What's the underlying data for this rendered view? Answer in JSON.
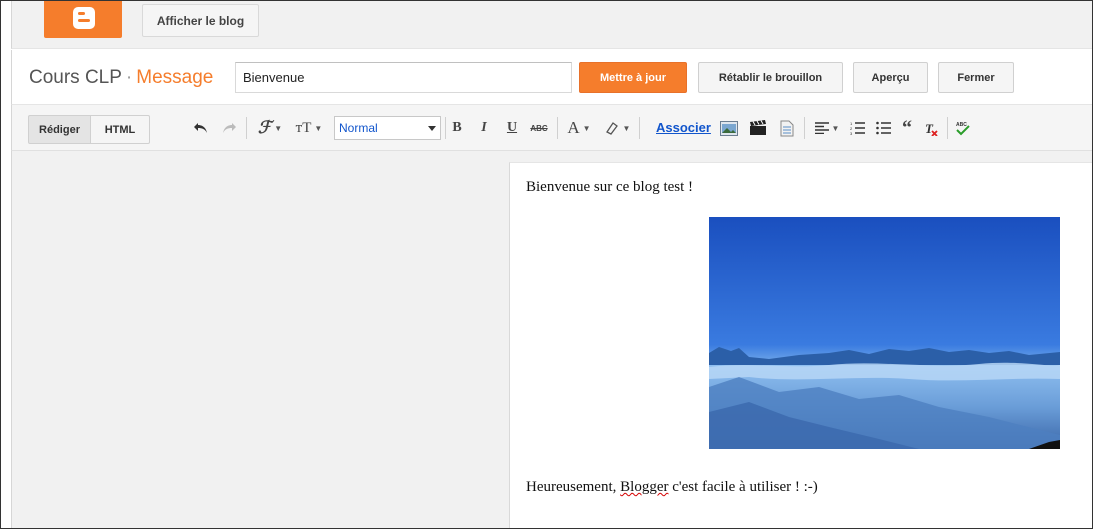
{
  "topbar": {
    "logo_icon": "blogger-icon",
    "view_blog_label": "Afficher le blog"
  },
  "header": {
    "site_name": "Cours CLP",
    "separator": "·",
    "page_name": "Message",
    "post_title_value": "Bienvenue",
    "update_label": "Mettre à jour",
    "revert_label": "Rétablir le brouillon",
    "preview_label": "Aperçu",
    "close_label": "Fermer"
  },
  "toolbar": {
    "compose_label": "Rédiger",
    "html_label": "HTML",
    "format_value": "Normal",
    "link_label": "Associer",
    "icons": [
      "undo-icon",
      "redo-icon",
      "font-family-icon",
      "font-size-icon",
      "bold-icon",
      "italic-icon",
      "underline-icon",
      "strikethrough-icon",
      "text-color-icon",
      "highlight-icon",
      "insert-image-icon",
      "insert-video-icon",
      "insert-jump-break-icon",
      "align-icon",
      "numbered-list-icon",
      "bulleted-list-icon",
      "quote-icon",
      "clear-formatting-icon",
      "spellcheck-icon"
    ]
  },
  "editor": {
    "line1": "Bienvenue sur ce blog test !",
    "line2_prefix": "Heureusement, ",
    "line2_misspelled": "Blogger",
    "line2_suffix": " c'est facile à utiliser ! :-)"
  },
  "colors": {
    "accent": "#f57d2c",
    "link": "#1155cc",
    "toolbar_bg": "#f5f5f5"
  }
}
